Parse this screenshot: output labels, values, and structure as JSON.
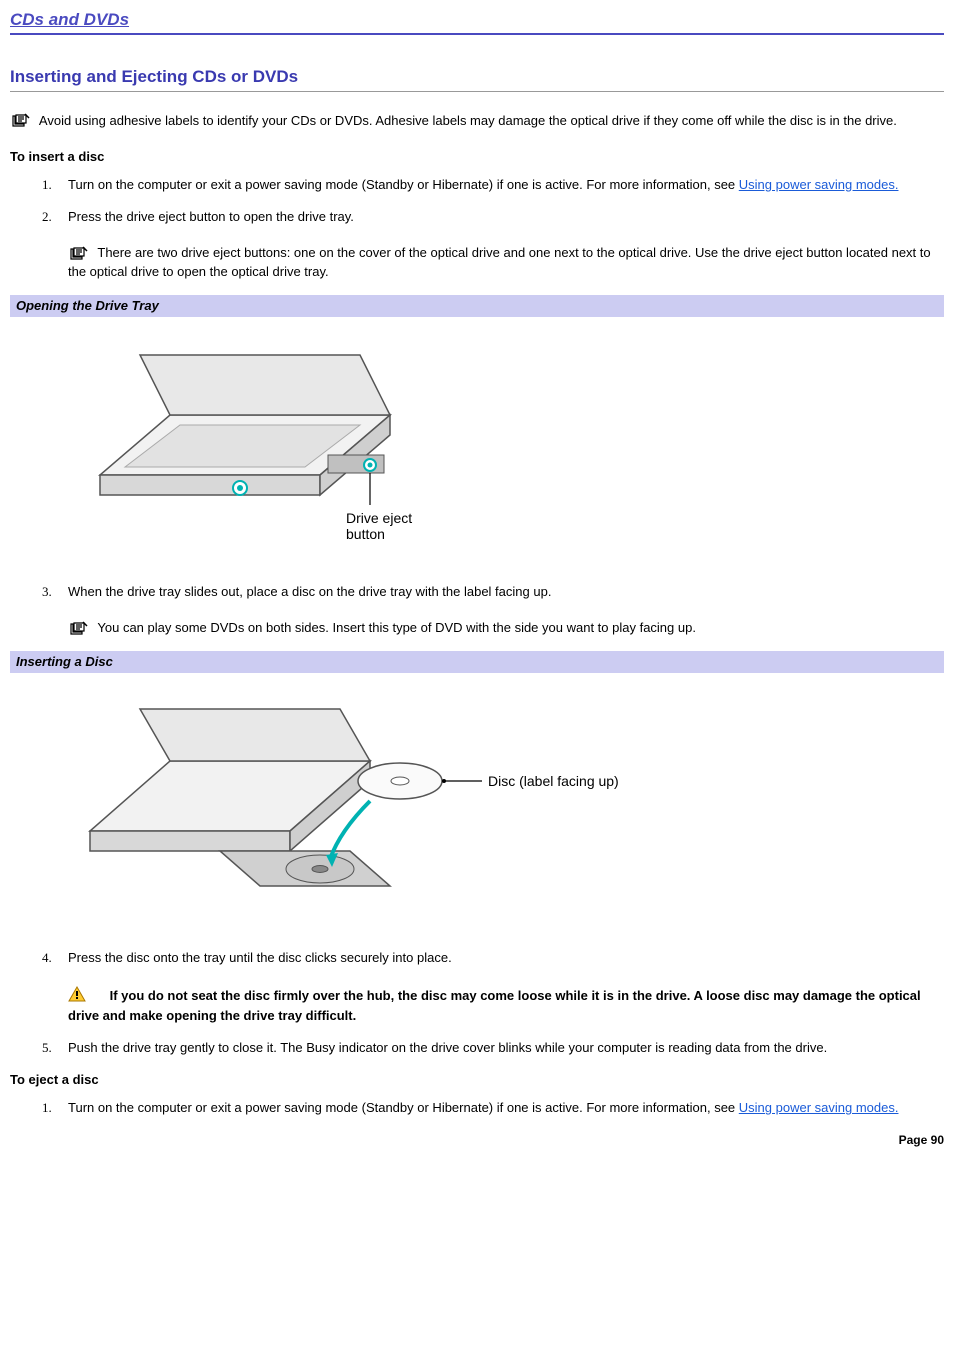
{
  "page": {
    "title": "CDs and DVDs",
    "section_title": "Inserting and Ejecting CDs or DVDs",
    "page_number": "Page 90"
  },
  "intro_note": "Avoid using adhesive labels to identify your CDs or DVDs. Adhesive labels may damage the optical drive if they come off while the disc is in the drive.",
  "insert": {
    "heading": "To insert a disc",
    "steps": {
      "s1_num": "1.",
      "s1_pre": "Turn on the computer or exit a power saving mode (Standby or Hibernate) if one is active. For more information, see ",
      "s1_link": "Using power saving modes.",
      "s2_num": "2.",
      "s2_text": "Press the drive eject button to open the drive tray.",
      "s2_note": "There are two drive eject buttons: one on the cover of the optical drive and one next to the optical drive. Use the drive eject button located next to the optical drive to open the optical drive tray.",
      "s3_num": "3.",
      "s3_text": "When the drive tray slides out, place a disc on the drive tray with the label facing up.",
      "s3_note": "You can play some DVDs on both sides. Insert this type of DVD with the side you want to play facing up.",
      "s4_num": "4.",
      "s4_text": "Press the disc onto the tray until the disc clicks securely into place.",
      "s4_warn": "If you do not seat the disc firmly over the hub, the disc may come loose while it is in the drive. A loose disc may damage the optical drive and make opening the drive tray difficult.",
      "s5_num": "5.",
      "s5_text": "Push the drive tray gently to close it. The Busy indicator on the drive cover blinks while your computer is reading data from the drive."
    }
  },
  "figures": {
    "fig1_caption": "Opening the Drive Tray",
    "fig1_label1": "Drive eject",
    "fig1_label2": "button",
    "fig2_caption": "Inserting a Disc",
    "fig2_label": "Disc (label facing up)"
  },
  "eject": {
    "heading": "To eject a disc",
    "s1_num": "1.",
    "s1_pre": "Turn on the computer or exit a power saving mode (Standby or Hibernate) if one is active. For more information, see ",
    "s1_link": "Using power saving modes."
  }
}
